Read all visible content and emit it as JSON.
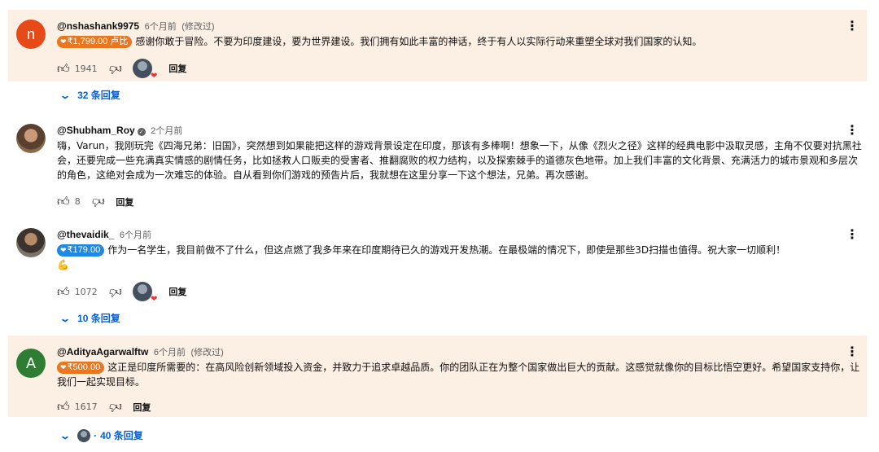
{
  "comments": [
    {
      "avatar_letter": "n",
      "handle": "@nshashank9975",
      "time": "6个月前",
      "edited": "(修改过)",
      "chip_amount": "₹1,799.00 卢比",
      "text": "感谢你敢于冒险。不要为印度建设，要为世界建设。我们拥有如此丰富的神话，终于有人以实际行动来重塑全球对我们国家的认知。",
      "likes": "1941",
      "reply_label": "回复",
      "replies": "32 条回复"
    },
    {
      "handle": "@Shubham_Roy",
      "time": "2个月前",
      "text": "嗨，Varun，我刚玩完《四海兄弟：旧国》，突然想到如果能把这样的游戏背景设定在印度，那该有多棒啊！想象一下，从像《烈火之径》这样的经典电影中汲取灵感，主角不仅要对抗黑社会，还要完成一些充满真实情感的剧情任务，比如拯救人口贩卖的受害者、推翻腐败的权力结构，以及探索棘手的道德灰色地带。加上我们丰富的文化背景、充满活力的城市景观和多层次的角色，这绝对会成为一次难忘的体验。自从看到你们游戏的预告片后，我就想在这里分享一下这个想法，兄弟。再次感谢。",
      "likes": "8",
      "reply_label": "回复"
    },
    {
      "handle": "@thevaidik_",
      "time": "6个月前",
      "chip_amount": "₹179.00",
      "text": "作为一名学生，我目前做不了什么，但这点燃了我多年来在印度期待已久的游戏开发热潮。在最极端的情况下，即使是那些3D扫描也值得。祝大家一切顺利！",
      "emoji": "💪",
      "likes": "1072",
      "reply_label": "回复",
      "replies": "10 条回复"
    },
    {
      "avatar_letter": "A",
      "handle": "@AdityaAgarwalftw",
      "time": "6个月前",
      "edited": "(修改过)",
      "chip_amount": "₹500.00",
      "text": "这正是印度所需要的：在高风险创新领域投入资金，并致力于追求卓越品质。你的团队正在为整个国家做出巨大的贡献。这感觉就像你的目标比悟空更好。希望国家支持你，让我们一起实现目标。",
      "likes": "1617",
      "reply_label": "回复",
      "replies": "40 条回复"
    }
  ],
  "colors": {
    "highlight_bg": "#fcefe4",
    "chip_orange": "#e8771f",
    "chip_blue": "#1e88e5",
    "link_blue": "#065fd4"
  }
}
